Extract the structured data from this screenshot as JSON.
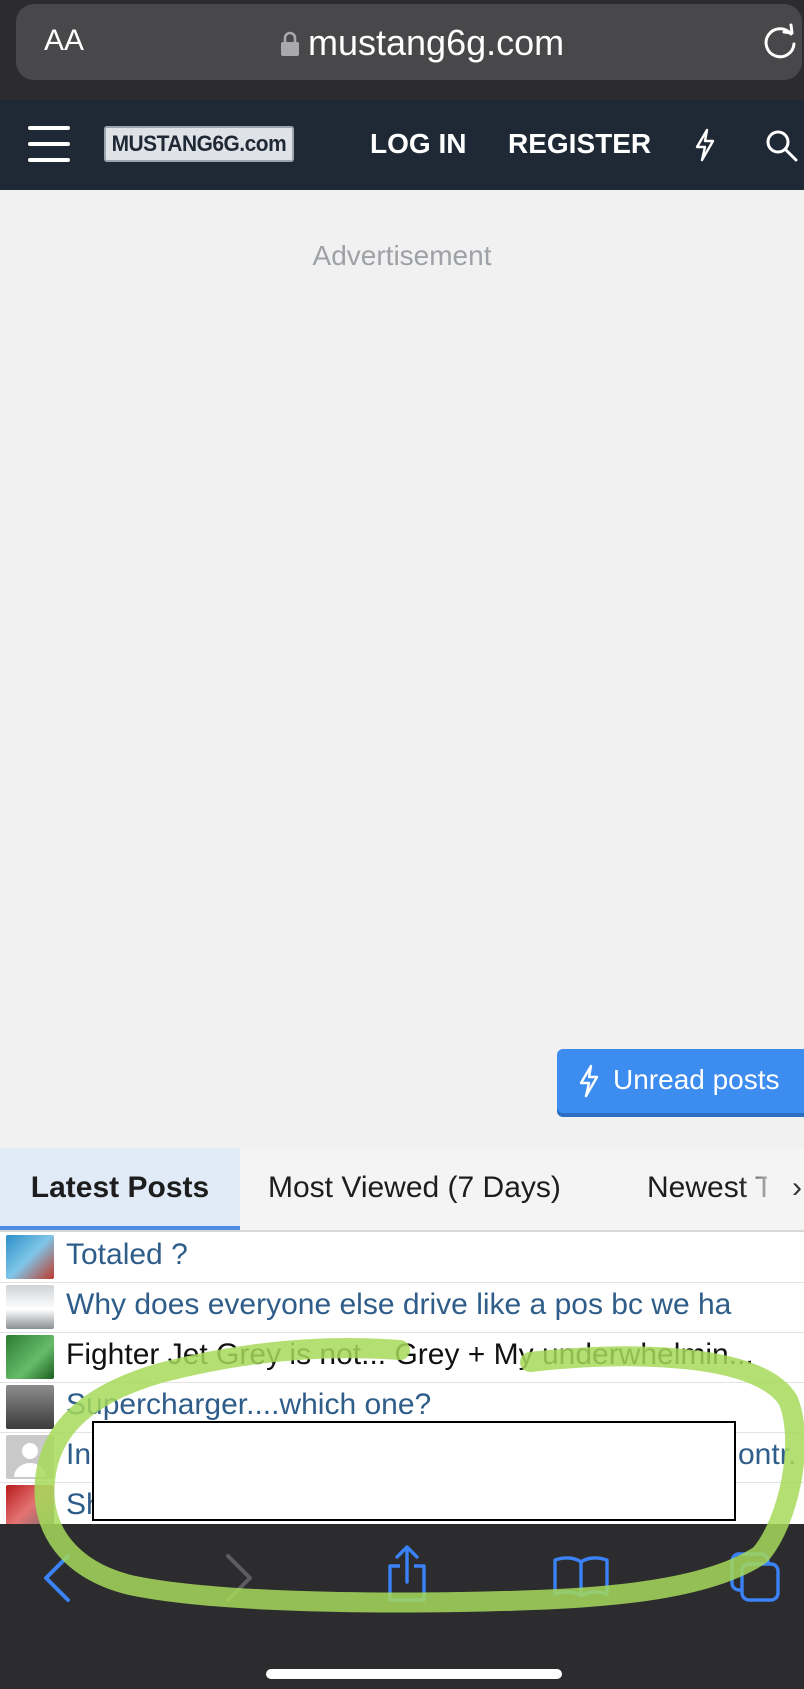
{
  "browser": {
    "text_size_label": "AA",
    "url": "mustang6g.com"
  },
  "header": {
    "logo_text": "MUSTANG6G.com",
    "login": "LOG IN",
    "register": "REGISTER"
  },
  "ad": {
    "label": "Advertisement"
  },
  "unread_button": {
    "label": "Unread posts"
  },
  "tabs": [
    {
      "label": "Latest Posts",
      "active": true
    },
    {
      "label": "Most Viewed (7 Days)",
      "active": false
    },
    {
      "label": "Newest T",
      "active": false
    }
  ],
  "threads": [
    {
      "title": "Totaled ?"
    },
    {
      "title": "Why does everyone else drive like a pos bc we ha"
    },
    {
      "title": "Fighter Jet Grey is not... Grey + My underwhelmin..."
    },
    {
      "title": "Supercharger....which one?"
    },
    {
      "title": "In",
      "title_end": "ontr."
    },
    {
      "title": "Sh"
    }
  ],
  "colors": {
    "header_bg": "#1f2935",
    "accent_blue": "#3d8df0",
    "link_blue": "#2f5d8a",
    "highlight_green": "#a6d95a",
    "safari_chrome": "#2c2c2e"
  }
}
